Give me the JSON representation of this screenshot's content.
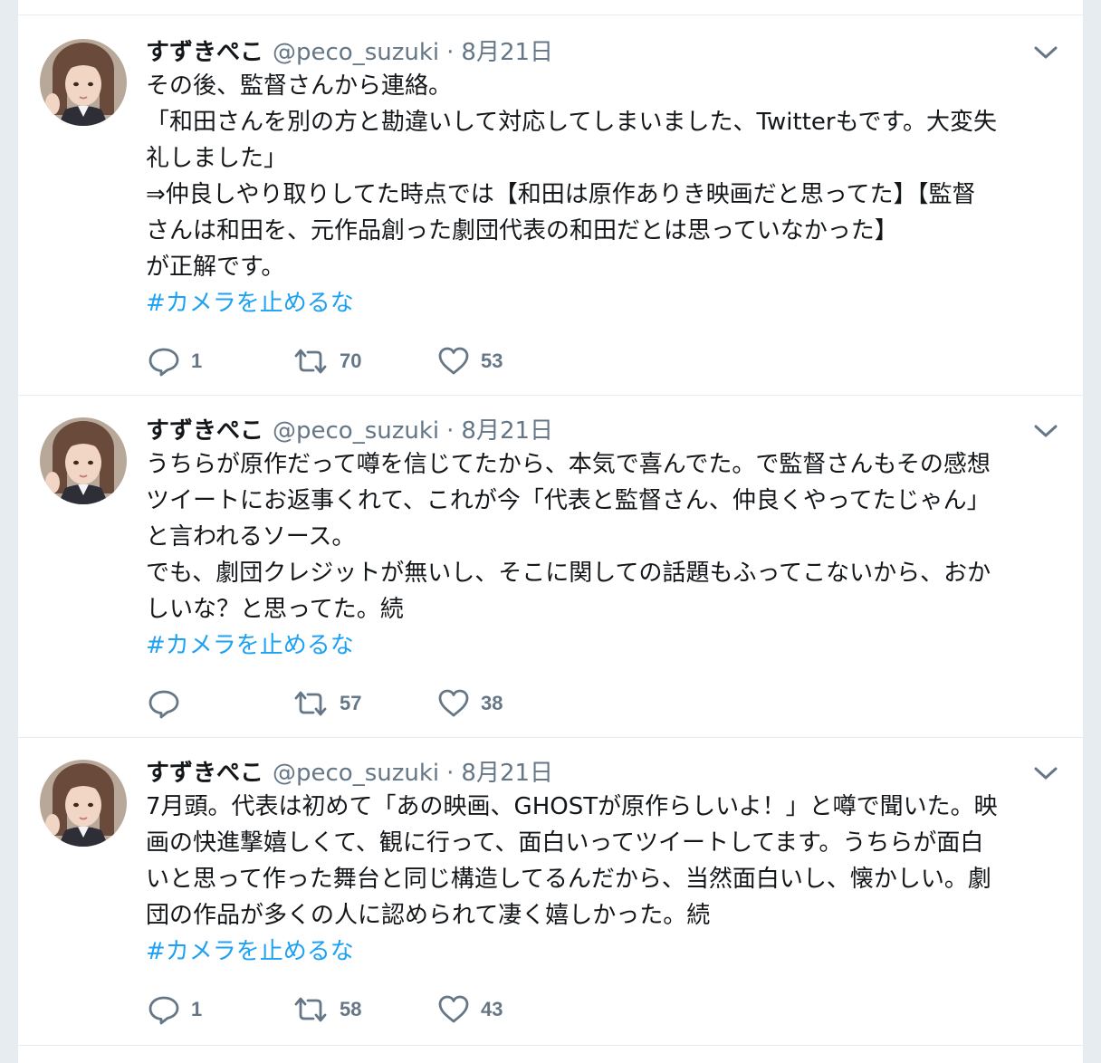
{
  "tweets": [
    {
      "name": "すずきぺこ",
      "handle": "@peco_suzuki",
      "separator": "·",
      "date": "8月21日",
      "text": "その後、監督さんから連絡。\n「和田さんを別の方と勘違いして対応してしまいました、Twitterもです。大変失\n礼しました」\n⇒仲良しやり取りしてた時点では【和田は原作ありき映画だと思ってた】【監督\nさんは和田を、元作品創った劇団代表の和田だとは思っていなかった】\nが正解です。",
      "hashtag": "#カメラを止めるな",
      "replies": "1",
      "retweets": "70",
      "likes": "53"
    },
    {
      "name": "すずきぺこ",
      "handle": "@peco_suzuki",
      "separator": "·",
      "date": "8月21日",
      "text": "うちらが原作だって噂を信じてたから、本気で喜んでた。で監督さんもその感想\nツイートにお返事くれて、これが今「代表と監督さん、仲良くやってたじゃん」\nと言われるソース。\nでも、劇団クレジットが無いし、そこに関しての話題もふってこないから、おか\nしいな？と思ってた。続",
      "hashtag": "#カメラを止めるな",
      "replies": "",
      "retweets": "57",
      "likes": "38"
    },
    {
      "name": "すずきぺこ",
      "handle": "@peco_suzuki",
      "separator": "·",
      "date": "8月21日",
      "text": "7月頭。代表は初めて「あの映画、GHOSTが原作らしいよ！」と噂で聞いた。映\n画の快進撃嬉しくて、観に行って、面白いってツイートしてます。うちらが面白\nいと思って作った舞台と同じ構造してるんだから、当然面白いし、懐かしい。劇\n団の作品が多くの人に認められて凄く嬉しかった。続",
      "hashtag": "#カメラを止めるな",
      "replies": "1",
      "retweets": "58",
      "likes": "43"
    }
  ],
  "icons": {
    "reply": "reply-icon",
    "retweet": "retweet-icon",
    "like": "heart-icon",
    "caret": "chevron-down-icon",
    "avatar": "avatar"
  },
  "colors": {
    "text": "#14171a",
    "secondary": "#657786",
    "link": "#1da1f2",
    "background": "#e6ecf0"
  }
}
